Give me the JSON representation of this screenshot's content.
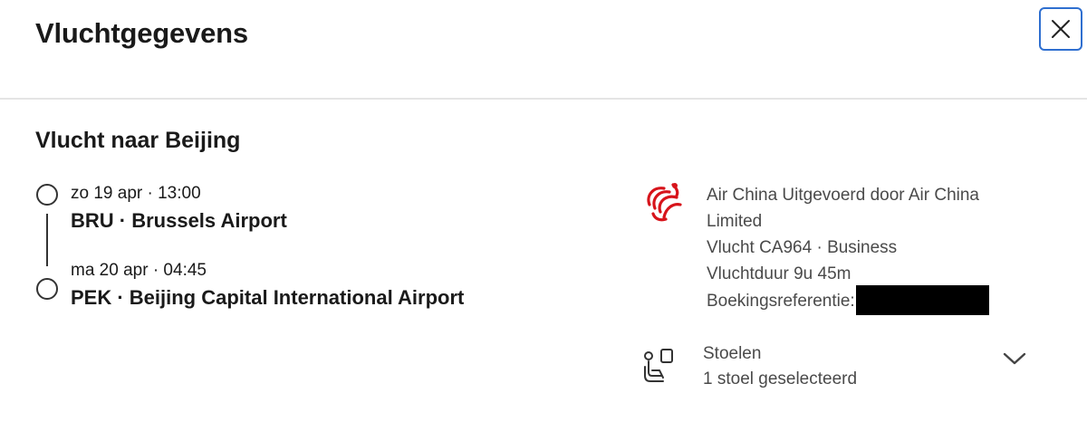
{
  "header": {
    "title": "Vluchtgegevens",
    "close_icon": "close-icon"
  },
  "flight": {
    "section_title": "Vlucht naar Beijing",
    "departure": {
      "time": "zo 19 apr · 13:00",
      "airport": "BRU · Brussels Airport"
    },
    "arrival": {
      "time": "ma 20 apr · 04:45",
      "airport": "PEK · Beijing Capital International Airport"
    }
  },
  "airline": {
    "logo_icon": "air-china-logo",
    "brand_color": "#d7141b",
    "line1": "Air China Uitgevoerd door Air China",
    "line2": "Limited",
    "flight_line": "Vlucht CA964 · Business",
    "duration": "Vluchtduur 9u 45m",
    "booking_label": "Boekingsreferentie:"
  },
  "seats": {
    "icon": "seat-icon",
    "label": "Stoelen",
    "selected": "1 stoel geselecteerd",
    "expand_icon": "chevron-down-icon"
  },
  "colors": {
    "focus_border": "#2f6fd0",
    "divider": "#e4e4e4"
  }
}
